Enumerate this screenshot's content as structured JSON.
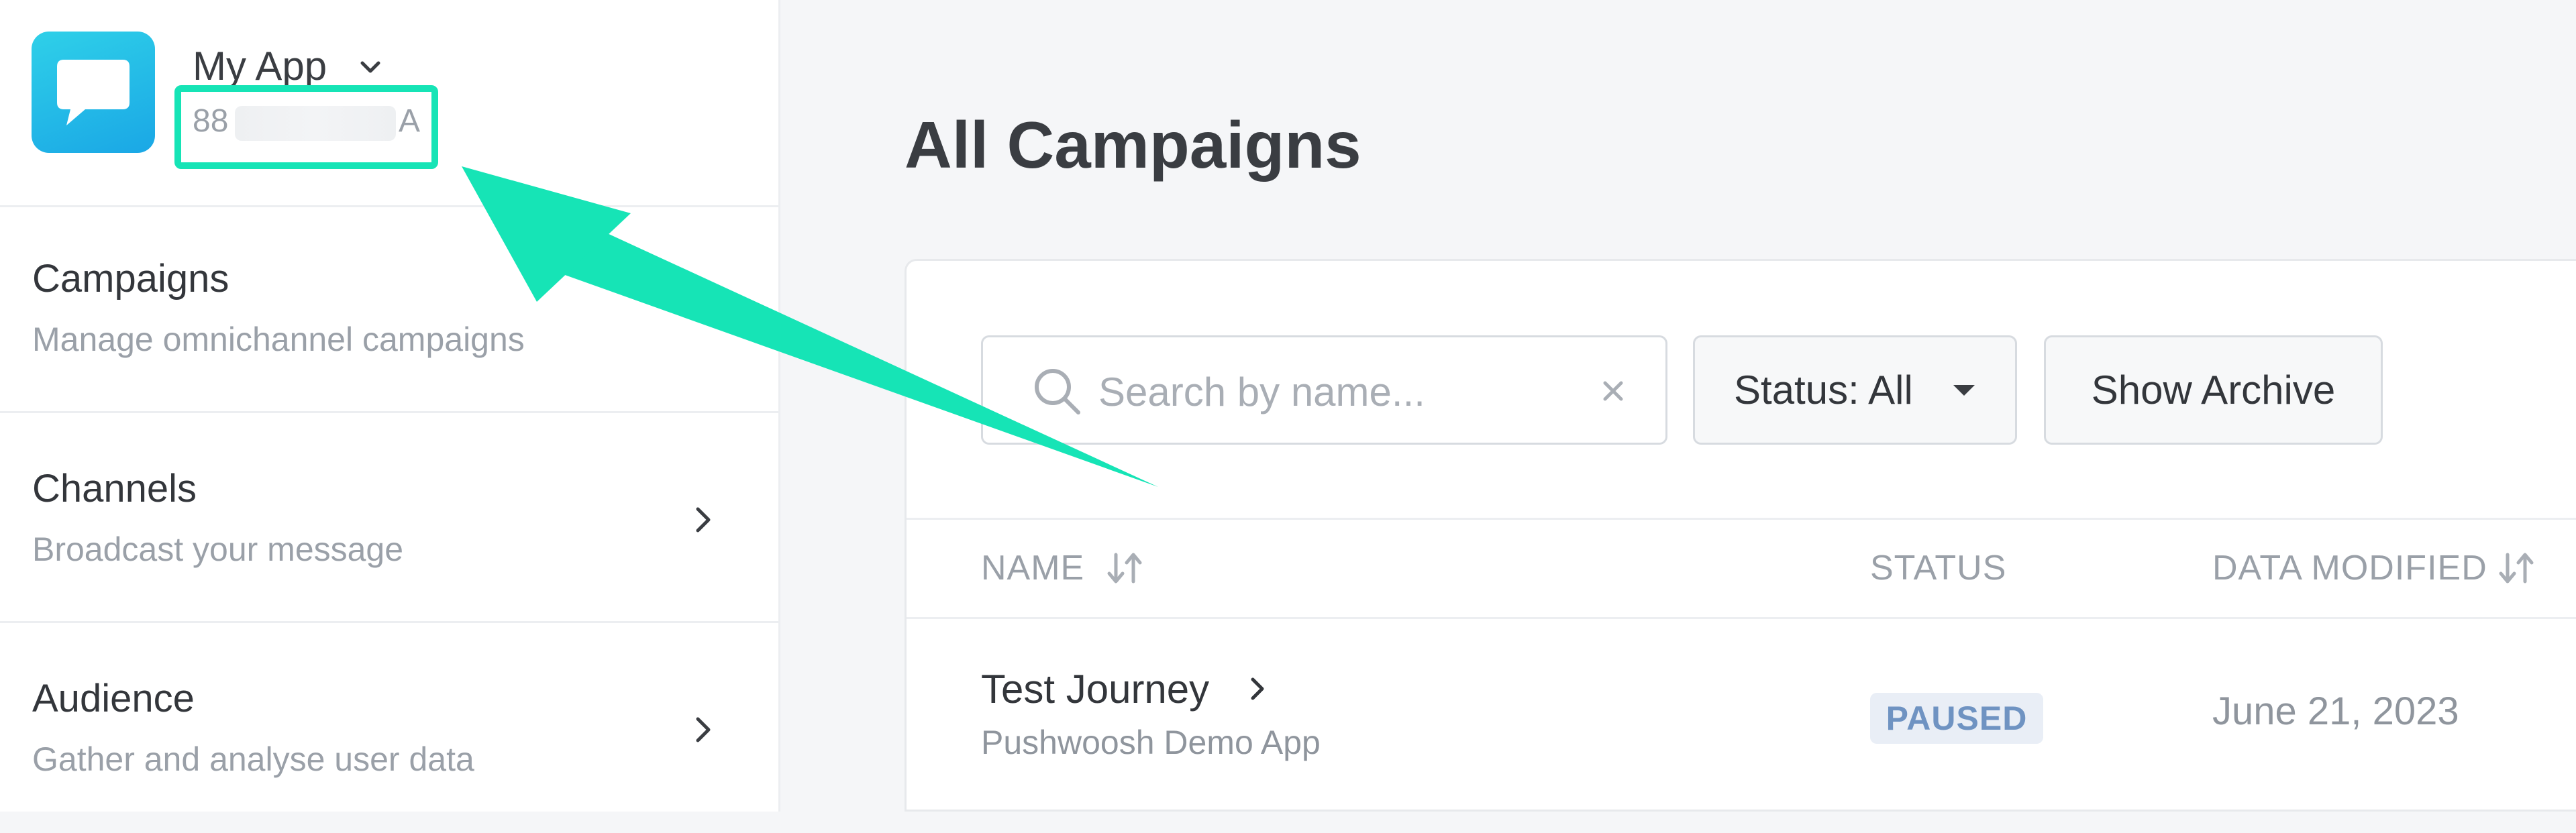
{
  "app": {
    "name": "My App",
    "id_prefix": "88",
    "id_suffix": "A"
  },
  "sidebar": {
    "items": [
      {
        "title": "Campaigns",
        "subtitle": "Manage omnichannel campaigns"
      },
      {
        "title": "Channels",
        "subtitle": "Broadcast your message"
      },
      {
        "title": "Audience",
        "subtitle": "Gather and analyse user data"
      }
    ]
  },
  "main": {
    "title": "All Campaigns",
    "search": {
      "placeholder": "Search by name..."
    },
    "status_filter": "Status: All",
    "archive_button": "Show Archive",
    "columns": {
      "name": "NAME",
      "status": "STATUS",
      "modified": "DATA MODIFIED"
    },
    "rows": [
      {
        "name": "Test Journey",
        "app": "Pushwoosh Demo App",
        "status": "PAUSED",
        "modified": "June 21, 2023"
      }
    ]
  },
  "colors": {
    "accent_highlight": "#16e4b6",
    "logo_start": "#2fd0e8",
    "logo_end": "#1aa7e6",
    "badge_bg": "#e9eef6",
    "badge_text": "#6f93c2"
  }
}
